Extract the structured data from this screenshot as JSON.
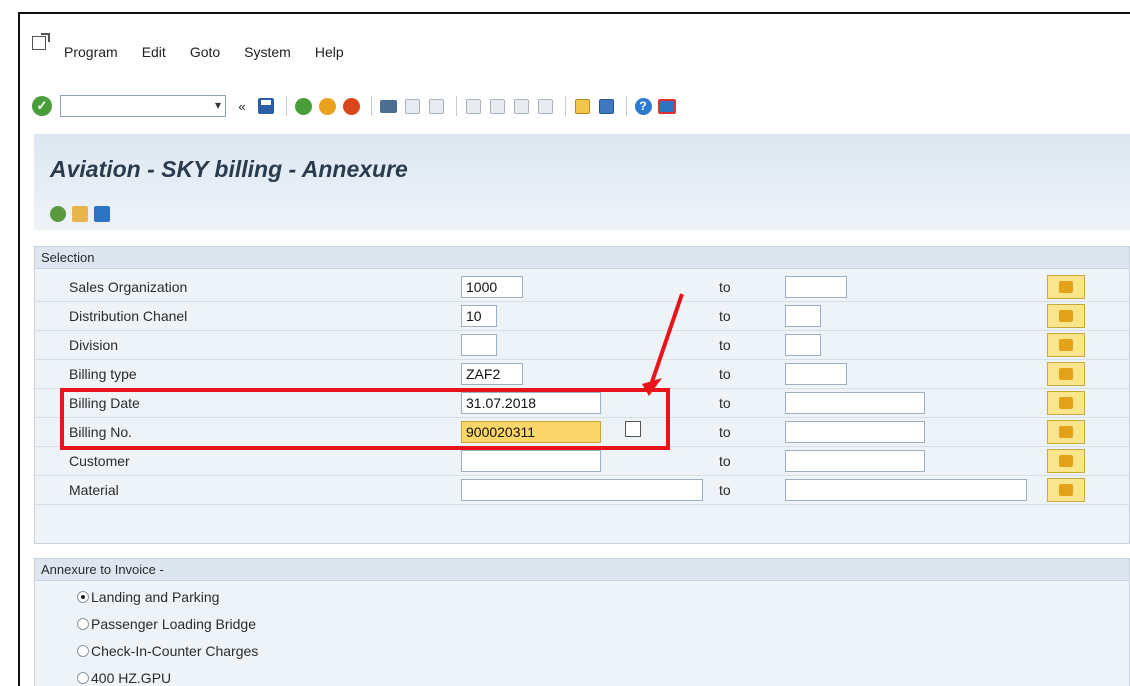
{
  "menu": {
    "items": [
      "Program",
      "Edit",
      "Goto",
      "System",
      "Help"
    ]
  },
  "toolbar": {
    "command_value": "",
    "icons": [
      "ok-icon",
      "save-icon",
      "back-icon",
      "exit-icon",
      "cancel-icon",
      "print-icon",
      "find-icon",
      "find-next-icon",
      "first-page-icon",
      "previous-page-icon",
      "next-page-icon",
      "last-page-icon",
      "new-session-icon",
      "shortcut-icon",
      "help-icon",
      "customize-icon"
    ]
  },
  "title": "Aviation - SKY billing - Annexure",
  "selection": {
    "header": "Selection",
    "to_label": "to",
    "rows": [
      {
        "label": "Sales Organization",
        "from": "1000",
        "to": ""
      },
      {
        "label": "Distribution Chanel",
        "from": "10",
        "to": ""
      },
      {
        "label": "Division",
        "from": "",
        "to": ""
      },
      {
        "label": "Billing type",
        "from": "ZAF2",
        "to": ""
      },
      {
        "label": "Billing Date",
        "from": "31.07.2018",
        "to": ""
      },
      {
        "label": "Billing No.",
        "from": "900020311",
        "to": ""
      },
      {
        "label": "Customer",
        "from": "",
        "to": ""
      },
      {
        "label": "Material",
        "from": "",
        "to": ""
      }
    ]
  },
  "annexure": {
    "header": "Annexure to Invoice -",
    "options": [
      {
        "label": "Landing and Parking",
        "selected": true
      },
      {
        "label": "Passenger Loading Bridge",
        "selected": false
      },
      {
        "label": "Check-In-Counter Charges",
        "selected": false
      },
      {
        "label": "400 HZ.GPU",
        "selected": false
      }
    ]
  },
  "colors": {
    "annotation": "#e8141c",
    "highlight_field": "#fbd66a",
    "title_band": "#dde7f1"
  }
}
